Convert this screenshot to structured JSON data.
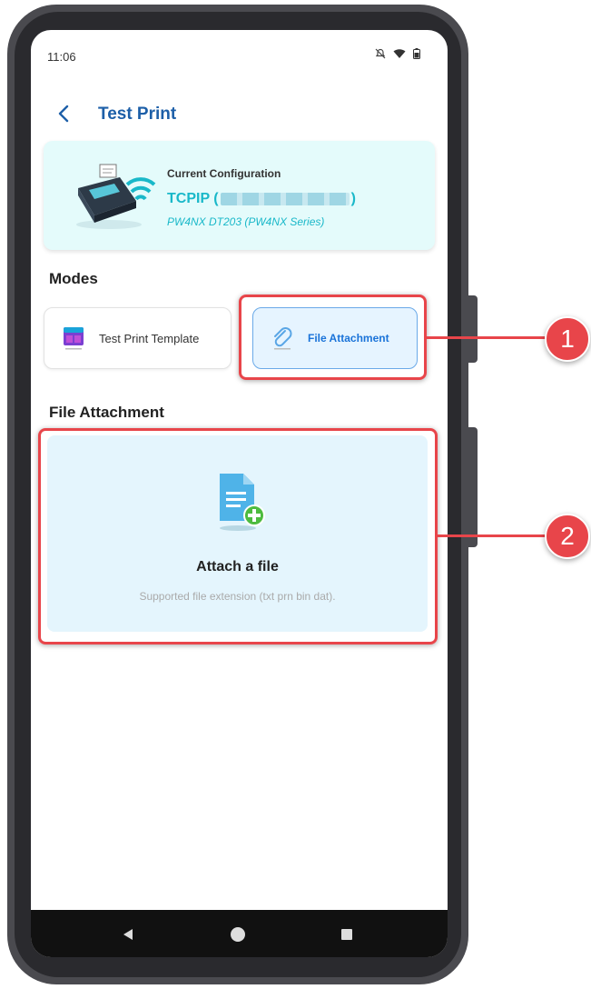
{
  "status_bar": {
    "time": "11:06"
  },
  "appbar": {
    "title": "Test Print"
  },
  "config": {
    "label": "Current Configuration",
    "connection_prefix": "TCPIP (",
    "connection_suffix": ")",
    "model": "PW4NX DT203 (PW4NX Series)"
  },
  "modes": {
    "title": "Modes",
    "template_label": "Test Print Template",
    "file_label": "File Attachment"
  },
  "file_attachment": {
    "title": "File Attachment",
    "action": "Attach a file",
    "hint": "Supported file extension (txt prn bin dat)."
  },
  "callouts": {
    "one": "1",
    "two": "2"
  },
  "colors": {
    "accent": "#1d5fa8",
    "highlight": "#e8454a",
    "teal": "#19b8c9"
  }
}
